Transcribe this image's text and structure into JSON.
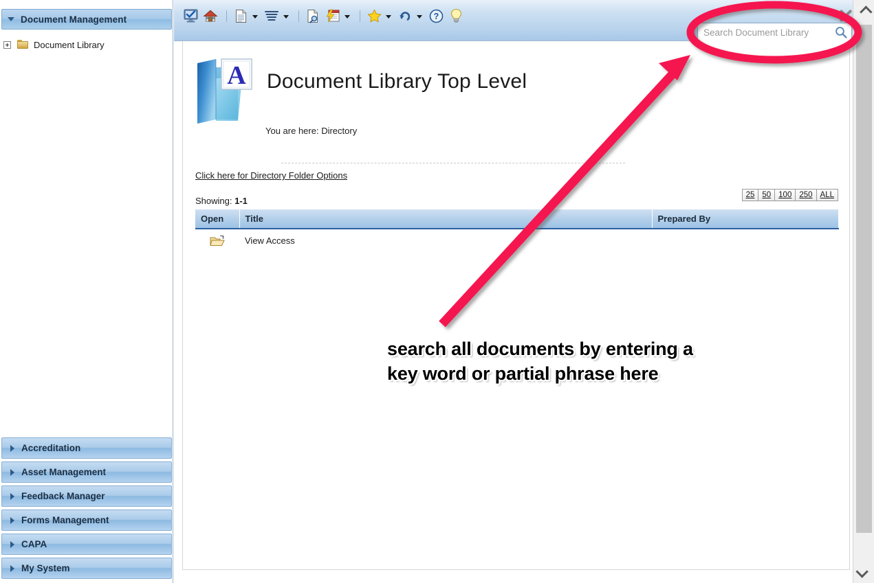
{
  "sidebar": {
    "header": {
      "title": "Document Management",
      "icon": "caret-down-icon"
    },
    "tree": [
      {
        "label": "Document Library",
        "expander": "plus-box-icon",
        "icon": "folder-icon"
      }
    ],
    "nav_sections": [
      {
        "label": "Accreditation"
      },
      {
        "label": "Asset Management"
      },
      {
        "label": "Feedback Manager"
      },
      {
        "label": "Forms Management"
      },
      {
        "label": "CAPA"
      },
      {
        "label": "My System"
      }
    ]
  },
  "toolbar": {
    "buttons": [
      {
        "name": "monitor-check-icon",
        "title": "Monitor"
      },
      {
        "name": "home-icon",
        "title": "Home"
      },
      {
        "name": "document-icon",
        "title": "Document",
        "has_dropdown": true
      },
      {
        "name": "list-lines-icon",
        "title": "List",
        "has_dropdown": true
      },
      {
        "name": "document-search-icon",
        "title": "Document Search"
      },
      {
        "name": "lightning-page-icon",
        "title": "Quick Action",
        "has_dropdown": true
      },
      {
        "name": "star-icon",
        "title": "Favorites",
        "has_dropdown": true
      },
      {
        "name": "undo-icon",
        "title": "Undo",
        "has_dropdown": true
      },
      {
        "name": "help-icon",
        "title": "Help"
      },
      {
        "name": "lightbulb-icon",
        "title": "Tips"
      }
    ],
    "close_label": "Close"
  },
  "search": {
    "placeholder": "Search Document Library",
    "value": "",
    "icon": "magnifier-icon"
  },
  "page": {
    "icon": "blue-folder-a-icon",
    "title": "Document Library Top Level",
    "breadcrumb": "You are here: Directory",
    "options_link": "Click here for Directory Folder Options",
    "showing_label": "Showing:",
    "showing_range": "1-1"
  },
  "pager": {
    "options": [
      "25",
      "50",
      "100",
      "250",
      "ALL"
    ]
  },
  "table": {
    "columns": [
      "Open",
      "Title",
      "Prepared By"
    ],
    "rows": [
      {
        "open_icon": "open-folder-icon",
        "title": "View Access",
        "prepared_by": ""
      }
    ]
  },
  "annotation": {
    "text": "search all documents by entering a key word or partial phrase here",
    "color": "#f5144f",
    "ellipse": "highlight-ellipse",
    "arrow": "callout-arrow"
  },
  "scrollbar": {
    "up_icon": "chevron-up-icon",
    "down_icon": "chevron-down-icon"
  }
}
